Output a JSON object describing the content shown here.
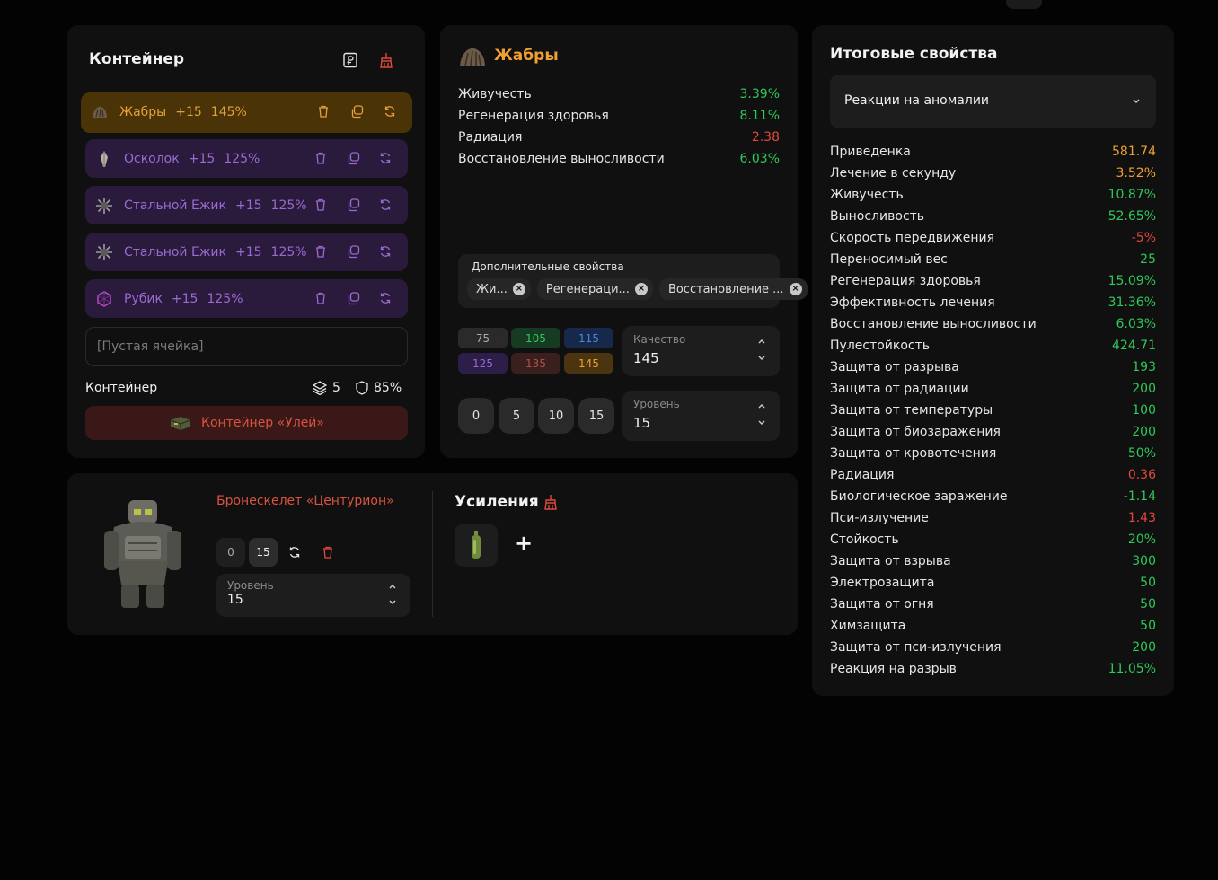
{
  "container": {
    "title": "Контейнер",
    "slots": [
      {
        "name": "Жабры",
        "plus": "+15",
        "pct": "145%"
      },
      {
        "name": "Осколок",
        "plus": "+15",
        "pct": "125%"
      },
      {
        "name": "Стальной Ежик",
        "plus": "+15",
        "pct": "125%"
      },
      {
        "name": "Стальной Ежик",
        "plus": "+15",
        "pct": "125%"
      },
      {
        "name": "Рубик",
        "plus": "+15",
        "pct": "125%"
      }
    ],
    "empty_slot": "[Пустая ячейка]",
    "footer_label": "Контейнер",
    "capacity": "5",
    "protection": "85%",
    "container_button": "Контейнер «Улей»"
  },
  "artifact": {
    "title": "Жабры",
    "stats": [
      {
        "label": "Живучесть",
        "value": "3.39%",
        "tone": "green"
      },
      {
        "label": "Регенерация здоровья",
        "value": "8.11%",
        "tone": "green"
      },
      {
        "label": "Радиация",
        "value": "2.38",
        "tone": "red"
      },
      {
        "label": "Восстановление выносливости",
        "value": "6.03%",
        "tone": "green"
      }
    ],
    "extra_title": "Дополнительные свойства",
    "extra_chips": [
      "Жи...",
      "Регенераци...",
      "Восстановление ..."
    ],
    "quality_buttons": [
      "75",
      "105",
      "115",
      "125",
      "135",
      "145"
    ],
    "quality": {
      "label": "Качество",
      "value": "145"
    },
    "level_buttons": [
      "0",
      "5",
      "10",
      "15"
    ],
    "level": {
      "label": "Уровень",
      "value": "15"
    }
  },
  "armor": {
    "name": "Бронескелет «Центурион»",
    "buttons": [
      "0",
      "15"
    ],
    "level": {
      "label": "Уровень",
      "value": "15"
    },
    "boosts_title": "Усиления",
    "add_label": "+"
  },
  "summary": {
    "title": "Итоговые свойства",
    "dropdown": "Реакции на аномалии",
    "stats": [
      {
        "label": "Приведенка",
        "value": "581.74",
        "tone": "orange"
      },
      {
        "label": "Лечение в секунду",
        "value": "3.52%",
        "tone": "orange"
      },
      {
        "label": "Живучесть",
        "value": "10.87%",
        "tone": "green"
      },
      {
        "label": "Выносливость",
        "value": "52.65%",
        "tone": "green"
      },
      {
        "label": "Скорость передвижения",
        "value": "-5%",
        "tone": "red"
      },
      {
        "label": "Переносимый вес",
        "value": "25",
        "tone": "green"
      },
      {
        "label": "Регенерация здоровья",
        "value": "15.09%",
        "tone": "green"
      },
      {
        "label": "Эффективность лечения",
        "value": "31.36%",
        "tone": "green"
      },
      {
        "label": "Восстановление выносливости",
        "value": "6.03%",
        "tone": "green"
      },
      {
        "label": "Пулестойкость",
        "value": "424.71",
        "tone": "green"
      },
      {
        "label": "Защита от разрыва",
        "value": "193",
        "tone": "green"
      },
      {
        "label": "Защита от радиации",
        "value": "200",
        "tone": "green"
      },
      {
        "label": "Защита от температуры",
        "value": "100",
        "tone": "green"
      },
      {
        "label": "Защита от биозаражения",
        "value": "200",
        "tone": "green"
      },
      {
        "label": "Защита от кровотечения",
        "value": "50%",
        "tone": "green"
      },
      {
        "label": "Радиация",
        "value": "0.36",
        "tone": "red"
      },
      {
        "label": "Биологическое заражение",
        "value": "-1.14",
        "tone": "green"
      },
      {
        "label": "Пси-излучение",
        "value": "1.43",
        "tone": "red"
      },
      {
        "label": "Стойкость",
        "value": "20%",
        "tone": "green"
      },
      {
        "label": "Защита от взрыва",
        "value": "300",
        "tone": "green"
      },
      {
        "label": "Электрозащита",
        "value": "50",
        "tone": "green"
      },
      {
        "label": "Защита от огня",
        "value": "50",
        "tone": "green"
      },
      {
        "label": "Химзащита",
        "value": "50",
        "tone": "green"
      },
      {
        "label": "Защита от пси-излучения",
        "value": "200",
        "tone": "green"
      },
      {
        "label": "Реакция на разрыв",
        "value": "11.05%",
        "tone": "green"
      }
    ]
  },
  "colors": {
    "green": "#2fc85a",
    "orange": "#f0a032",
    "red": "#e0483c"
  },
  "icons": [
    "ruble-icon",
    "broom-icon",
    "trash-icon",
    "copy-icon",
    "refresh-icon",
    "layers-icon",
    "shield-icon",
    "close-icon",
    "chevron-up-icon",
    "chevron-down-icon",
    "plus-icon"
  ]
}
